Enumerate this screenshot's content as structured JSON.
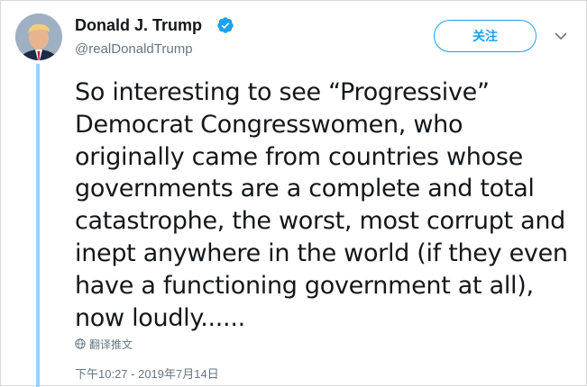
{
  "user": {
    "display_name": "Donald J. Trump",
    "handle": "@realDonaldTrump",
    "verified": true
  },
  "follow_button": {
    "label": "关注"
  },
  "tweet": {
    "lines": [
      "So interesting to see “Progressive”",
      "Democrat Congresswomen, who",
      "originally came from countries whose",
      "governments are a complete and total",
      "catastrophe, the worst, most corrupt and",
      "inept anywhere in the world (if they even",
      "have a functioning government at all),",
      "now loudly......"
    ],
    "translate_label": "翻译推文",
    "timestamp": "下午10:27 - 2019年7月14日"
  },
  "icons": {
    "verified": "verified-badge-icon",
    "more": "chevron-down-icon",
    "translate": "globe-icon"
  },
  "colors": {
    "accent": "#1da1f2",
    "thread_line": "#9fd1f5",
    "secondary_text": "#657786",
    "primary_text": "#14171a"
  }
}
